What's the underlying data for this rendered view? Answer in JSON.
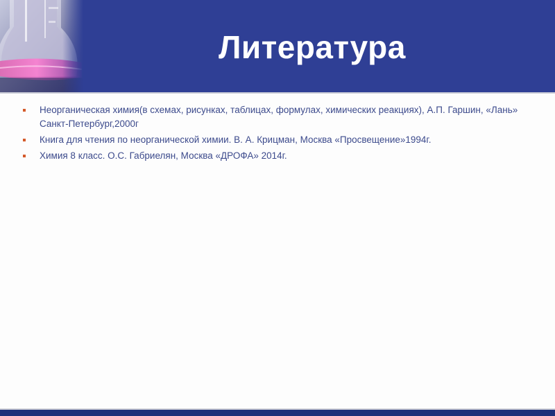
{
  "slide": {
    "title": "Литература",
    "bullets": [
      "Неорганическая химия(в схемах, рисунках, таблицах, формулах, химических реакциях), А.П. Гаршин, «Лань» Санкт-Петербург,2000г",
      "Книга для чтения по неорганической химии. В. А. Крицман, Москва «Просвещение»1994г.",
      "Химия 8 класс. О.С. Габриелян, Москва «ДРОФА» 2014г."
    ]
  },
  "colors": {
    "header_background": "#2f3f95",
    "title_text": "#ffffff",
    "bullet_text": "#3c4a8c",
    "bullet_marker": "#d45a2a",
    "bottom_bar": "#1d2f7a"
  },
  "icons": {
    "header_image": "glass-flask-image",
    "bullet": "square-bullet-icon"
  }
}
